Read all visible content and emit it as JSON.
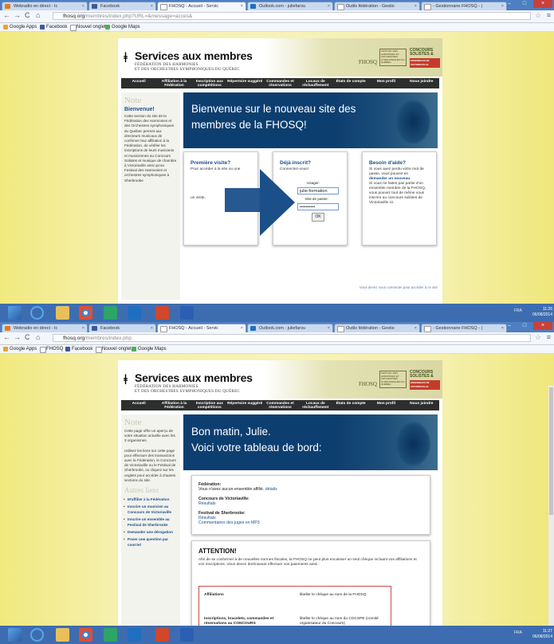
{
  "taskbar": {
    "time1": "11:26",
    "date1": "06/08/2014",
    "time2": "11:27",
    "date2": "06/08/2014",
    "lang": "FRA"
  },
  "tabs": [
    {
      "label": "Webradio en direct - Ic"
    },
    {
      "label": "Facebook"
    },
    {
      "label": "FHOSQ - Accueil - Servic"
    },
    {
      "label": "Outlook.com - juliefarou"
    },
    {
      "label": "Outils fédération - Gestio"
    },
    {
      "label": "- Gestionnaire FHOSQ - |"
    }
  ],
  "bookmarks": [
    "Google Apps",
    "FHOSQ",
    "Facebook",
    "Nouvel onglet",
    "Google Maps"
  ],
  "site": {
    "logo_title": "Services aux membres",
    "logo_sub1": "FÉDÉRATION DES HARMONIES",
    "logo_sub2": "ET DES ORCHESTRES SYMPHONIQUES DU QUÉBEC",
    "fhosq": "FHOSQ",
    "festival": "FESTIVAL DES HARMONIES ET ORCHESTRES SYMPHONIQUES DU QUÉBEC",
    "concours": "CONCOURS SOLISTES &",
    "concours_red": "ENSEMBLES DE VICTORIAVILLE",
    "nav": [
      "Accueil",
      "Affiliation à la Fédération",
      "Inscription aux compétitions",
      "Répertoire suggéré",
      "Commandes et réservations",
      "Locaux de réchauffement",
      "États de compte",
      "Mon profil",
      "Nous joindre"
    ]
  },
  "shot1": {
    "url_host": "fhosq.org",
    "url_path": "/membres/index.php?URL=&message=acces&",
    "note": "Note",
    "sb_heading": "Bienvenue!",
    "sb_text": "Cette section du site de la Fédération des Harmonies et des Orchestres symphoniques du Québec permet aux directeurs musicaux de confirmer leur affiliation à la Fédération, de vérifier les inscriptions de leurs musiciens et musiciennes au Concours Solistes et musique de chambre à Victoriaville ainsi qu'au Festival des Harmonies et orchestres symphoniques à Sherbrooke",
    "banner1": "Bienvenue sur le nouveau site des",
    "banner2": "membres de la FHOSQ!",
    "c1_title": "Première visite?",
    "c1_text": "Pour accéder à la site ou une",
    "c1_more": "un visite.",
    "c2_title": "Déjà inscrit?",
    "c2_text": "Connectez-vous!",
    "user_label": "Usager:",
    "user_value": "julie-formation",
    "pass_label": "Mot de passe:",
    "pass_value": "••••••••••",
    "ok": "OK",
    "c3_title": "Besoin d'aide?",
    "c3_text1": "Si vous avez perdu votre mot de passe, vous pouvez en",
    "c3_link": "demander un nouveau",
    "c3_text2": "Si vous ne faites pas partie d'un ensemble membre de la FHOSQ, vous pouvez tout de même vous inscrire au concours solistes de Victoriaville ici.",
    "foot": "Vous devez vous connecter pour accéder à ce site"
  },
  "shot2": {
    "url_host": "fhosq.org",
    "url_path": "/membres/index.php",
    "note": "Note",
    "sb_text1": "Cette page offre un aperçu de votre situation actuelle avec les 3 organismes.",
    "sb_text2": "Utilisez les liens sur cette page pour effectuer des transactions avec la Fédération, le Concours de Victoriaville ou le Festival de Sherbrooke, ou cliquez sur les onglets pour accéder à d'autres sections du site.",
    "autres": "Autres liens",
    "links": [
      "M'affilier à la Fédération",
      "Inscrire un musicien au Concours de Victoriaville",
      "Inscrire un ensemble au Festival de Sherbrooke",
      "Demander une dérogation",
      "Poser une question par courriel"
    ],
    "banner1": "Bon matin, Julie.",
    "banner2": "Voici votre tableau de bord:",
    "fed": "Fédération:",
    "fed_text": "Vous n'avez aucun ensemble affilié.",
    "fed_link": "détails",
    "conc": "Concours de Victoriaville:",
    "conc_link": "Résultats",
    "fest": "Festival de Sherbrooke:",
    "fest_link": "Résultats",
    "fest_link2": "Commentaires des juges en MP3",
    "att_title": "ATTENTION!",
    "att_text": "Afin de se conformer à de nouvelles normes fiscales, la FHOSQ ne peut plus encaisser un seul chèque incluant vos affiliations et vos inscriptions. Vous devez dorénavant effectuer vos paiements ainsi :",
    "row1_a": "Affiliations",
    "row1_b": "libeller le chèque au nom de la FHOSQ",
    "row2_a": "Inscriptions, bracelets, commandes et réservations au CONCOURS",
    "row2_b": "libeller le chèque au nom du COCSPE (comité organisateur du Concours)"
  }
}
